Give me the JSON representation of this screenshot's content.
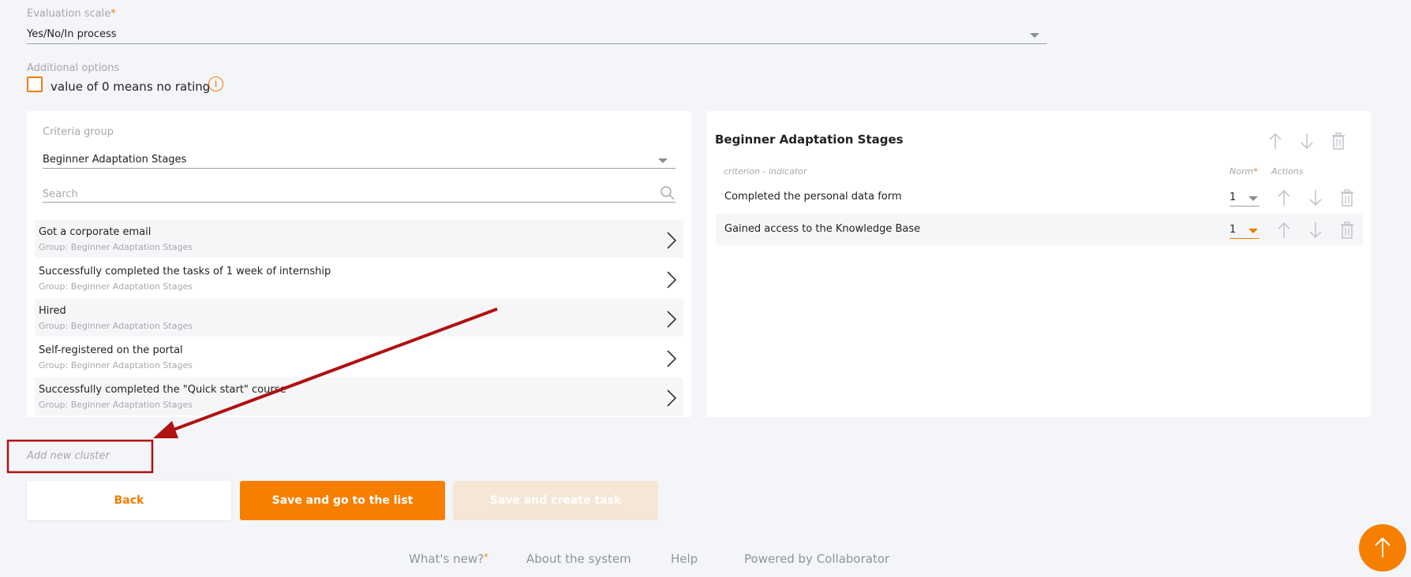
{
  "evaluation_scale": {
    "label": "Evaluation scale",
    "required_mark": "*",
    "value": "Yes/No/In process"
  },
  "additional_options": {
    "label": "Additional options",
    "checkbox_label": "value of 0 means no rating",
    "checked": false
  },
  "left_panel": {
    "group_label": "Criteria group",
    "group_value": "Beginner Adaptation Stages",
    "search_placeholder": "Search",
    "items": [
      {
        "title": "Got a corporate email",
        "group": "Group: Beginner Adaptation Stages"
      },
      {
        "title": "Successfully completed the tasks of 1 week of internship",
        "group": "Group: Beginner Adaptation Stages"
      },
      {
        "title": "Hired",
        "group": "Group: Beginner Adaptation Stages"
      },
      {
        "title": "Self-registered on the portal",
        "group": "Group: Beginner Adaptation Stages"
      },
      {
        "title": "Successfully completed the \"Quick start\" course",
        "group": "Group: Beginner Adaptation Stages"
      }
    ]
  },
  "right_panel": {
    "title": "Beginner Adaptation Stages",
    "col_indicator": "criterion - indicator",
    "col_norm": "Norm",
    "col_norm_required": "*",
    "col_actions": "Actions",
    "rows": [
      {
        "text": "Completed the personal data form",
        "norm": "1"
      },
      {
        "text": "Gained access to the Knowledge Base",
        "norm": "1"
      }
    ]
  },
  "add_cluster": {
    "label": "Add new cluster"
  },
  "buttons": {
    "back": "Back",
    "save_list": "Save and go to the list",
    "save_task": "Save and create task"
  },
  "footer": {
    "whats_new": "What's new?",
    "whats_new_mark": "*",
    "about": "About the system",
    "help": "Help",
    "powered": "Powered by Collaborator"
  },
  "colors": {
    "accent": "#f77f00",
    "annotation": "#b01111",
    "background": "#f4f5f9"
  },
  "icons": [
    "chevron-down-icon",
    "info-icon",
    "search-icon",
    "chevron-right-icon",
    "arrow-up-icon",
    "arrow-down-icon",
    "trash-icon"
  ]
}
